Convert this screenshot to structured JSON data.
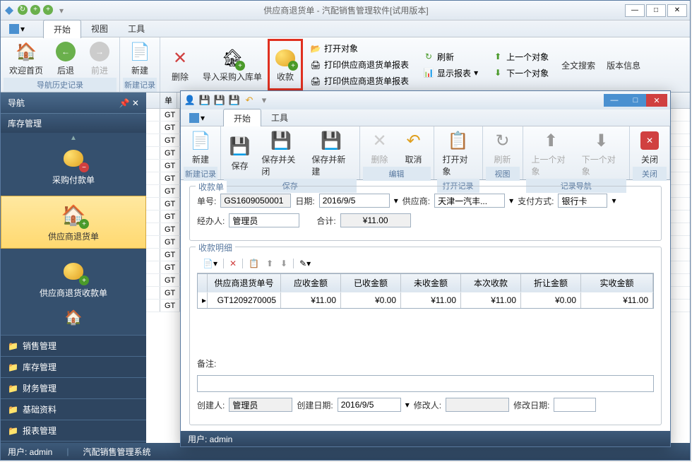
{
  "main": {
    "title": "供应商退货单 - 汽配销售管理软件[试用版本]",
    "tabs": [
      "开始",
      "视图",
      "工具"
    ],
    "ribbon": {
      "nav": {
        "home": "欢迎首页",
        "back": "后退",
        "fwd": "前进",
        "group": "导航历史记录"
      },
      "new": {
        "new": "新建",
        "group": "新建记录"
      },
      "edit": {
        "delete": "删除",
        "import": "导入采购入库单",
        "collect": "收款"
      },
      "print": {
        "open": "打开对象",
        "p1": "打印供应商退货单报表",
        "p2": "打印供应商退货单报表"
      },
      "view": {
        "refresh": "刷新",
        "show": "显示报表"
      },
      "rec": {
        "prev": "上一个对象",
        "next": "下一个对象"
      },
      "search": "全文搜索",
      "ver": "版本信息"
    },
    "nav_panel": {
      "title": "导航",
      "section": "库存管理",
      "items": [
        "采购付款单",
        "供应商退货单",
        "供应商退货收款单"
      ],
      "folders": [
        "销售管理",
        "库存管理",
        "财务管理",
        "基础资料",
        "报表管理"
      ]
    },
    "grid_col": "单",
    "grid_prefix": "GT",
    "status_user": "用户: admin",
    "status_app": "汽配销售管理系统"
  },
  "child": {
    "tabs": [
      "开始",
      "工具"
    ],
    "ribbon": {
      "new": "新建",
      "save": "保存",
      "saveclose": "保存并关闭",
      "savenew": "保存并新建",
      "delete": "删除",
      "cancel": "取消",
      "open": "打开对象",
      "refresh": "刷新",
      "prev": "上一个对象",
      "next": "下一个对象",
      "close": "关闭",
      "g_new": "新建记录",
      "g_save": "保存",
      "g_edit": "编辑",
      "g_open": "打开记录",
      "g_view": "视图",
      "g_nav": "记录导航",
      "g_close": "关闭"
    },
    "form": {
      "section1": "收款单",
      "no_label": "单号:",
      "no": "GS1609050001",
      "date_label": "日期:",
      "date": "2016/9/5",
      "supplier_label": "供应商:",
      "supplier": "天津一汽丰...",
      "pay_label": "支付方式:",
      "pay": "银行卡",
      "handler_label": "经办人:",
      "handler": "管理员",
      "total_label": "合计:",
      "total": "¥11.00",
      "section2": "收款明细",
      "cols": [
        "供应商退货单号",
        "应收金额",
        "已收金额",
        "未收金额",
        "本次收款",
        "折让金额",
        "实收金额"
      ],
      "row": [
        "GT1209270005",
        "¥11.00",
        "¥0.00",
        "¥11.00",
        "¥11.00",
        "¥0.00",
        "¥11.00"
      ],
      "remark_label": "备注:",
      "creator_label": "创建人:",
      "creator": "管理员",
      "cdate_label": "创建日期:",
      "cdate": "2016/9/5",
      "modifier_label": "修改人:",
      "mdate_label": "修改日期:"
    },
    "status": "用户: admin"
  }
}
